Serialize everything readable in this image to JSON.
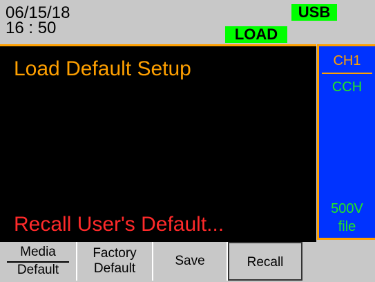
{
  "status": {
    "date": "06/15/18",
    "time": "16 : 50",
    "usb_badge": "USB",
    "load_badge": "LOAD"
  },
  "main": {
    "title": "Load Default Setup",
    "status_text": "Recall User's Default..."
  },
  "side_panel": {
    "channel": "CH1",
    "mode": "CCH",
    "voltage": "500V",
    "file": "file"
  },
  "softkeys": {
    "media": {
      "line1": "Media",
      "line2": "Default"
    },
    "factory": {
      "line1": "Factory",
      "line2": "Default"
    },
    "save": "Save",
    "recall": "Recall",
    "blank": ""
  },
  "colors": {
    "badge_green": "#00ff00",
    "orange": "#ffa000",
    "status_red": "#ff2a2a",
    "side_blue": "#0033ff",
    "text_green": "#22e822"
  }
}
